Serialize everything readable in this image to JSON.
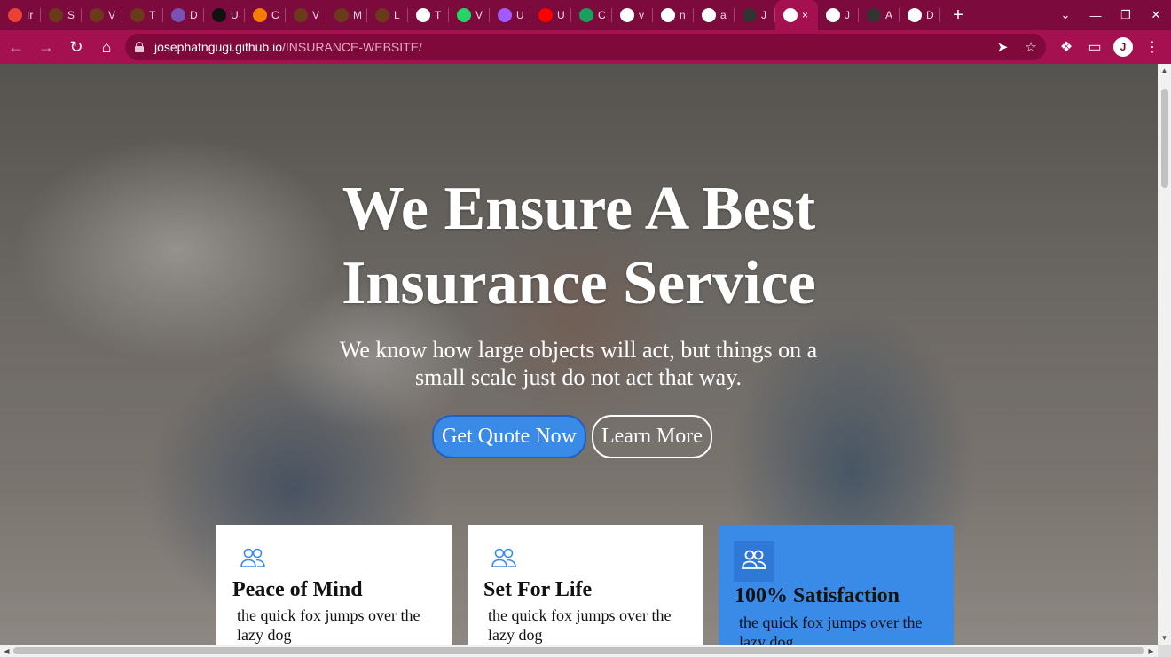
{
  "browser": {
    "tabs": [
      {
        "icon": "gmail-icon",
        "title": "Ir",
        "color": "#ea4335"
      },
      {
        "icon": "tree-icon",
        "title": "S",
        "color": "#6b3a1a"
      },
      {
        "icon": "tree-icon",
        "title": "V",
        "color": "#6b3a1a"
      },
      {
        "icon": "tree-icon",
        "title": "T",
        "color": "#6b3a1a"
      },
      {
        "icon": "bootstrap-icon",
        "title": "D",
        "color": "#7952b3"
      },
      {
        "icon": "tag-icon",
        "title": "U",
        "color": "#111111"
      },
      {
        "icon": "blogger-icon",
        "title": "C",
        "color": "#f57d00"
      },
      {
        "icon": "tree-icon",
        "title": "V",
        "color": "#6b3a1a"
      },
      {
        "icon": "tree-icon",
        "title": "M",
        "color": "#6b3a1a"
      },
      {
        "icon": "tree-icon",
        "title": "L",
        "color": "#6b3a1a"
      },
      {
        "icon": "globe-icon",
        "title": "T",
        "color": "#ffffff"
      },
      {
        "icon": "whatsapp-icon",
        "title": "V",
        "color": "#25d366"
      },
      {
        "icon": "figma-icon",
        "title": "U",
        "color": "#a259ff"
      },
      {
        "icon": "youtube-icon",
        "title": "U",
        "color": "#ff0000"
      },
      {
        "icon": "webflow-icon",
        "title": "C",
        "color": "#1d9e5e"
      },
      {
        "icon": "google-icon",
        "title": "v",
        "color": "#ffffff"
      },
      {
        "icon": "google-icon",
        "title": "n",
        "color": "#ffffff"
      },
      {
        "icon": "google-icon",
        "title": "a",
        "color": "#ffffff"
      },
      {
        "icon": "github-icon",
        "title": "J",
        "color": "#333333"
      }
    ],
    "active_tab": {
      "icon": "globe-icon",
      "close": "×"
    },
    "tabs_after": [
      {
        "icon": "globe-icon",
        "title": "J",
        "color": "#ffffff"
      },
      {
        "icon": "github-icon",
        "title": "A",
        "color": "#333333"
      },
      {
        "icon": "globe-icon",
        "title": "D",
        "color": "#ffffff"
      }
    ],
    "new_tab": "+",
    "url_host": "josephatngugi.github.io",
    "url_path": "/INSURANCE-WEBSITE/",
    "profile_initial": "J"
  },
  "hero": {
    "title_line1": "We Ensure A Best",
    "title_line2": "Insurance Service",
    "subtitle": "We know how large objects will act, but things on a small scale just do not act that way.",
    "primary_button": "Get Quote Now",
    "secondary_button": "Learn More"
  },
  "features": [
    {
      "icon": "users-icon",
      "title": "Peace of Mind",
      "text": "the quick fox jumps over the lazy dog",
      "highlight": false
    },
    {
      "icon": "users-icon",
      "title": "Set For Life",
      "text": "the quick fox jumps over the lazy dog",
      "highlight": false
    },
    {
      "icon": "users-icon",
      "title": "100% Satisfaction",
      "text": "the quick fox jumps over the lazy dog",
      "highlight": true
    }
  ],
  "colors": {
    "browser_frame": "#7d0a3c",
    "toolbar": "#a51050",
    "accent_blue": "#3a8ae8"
  }
}
